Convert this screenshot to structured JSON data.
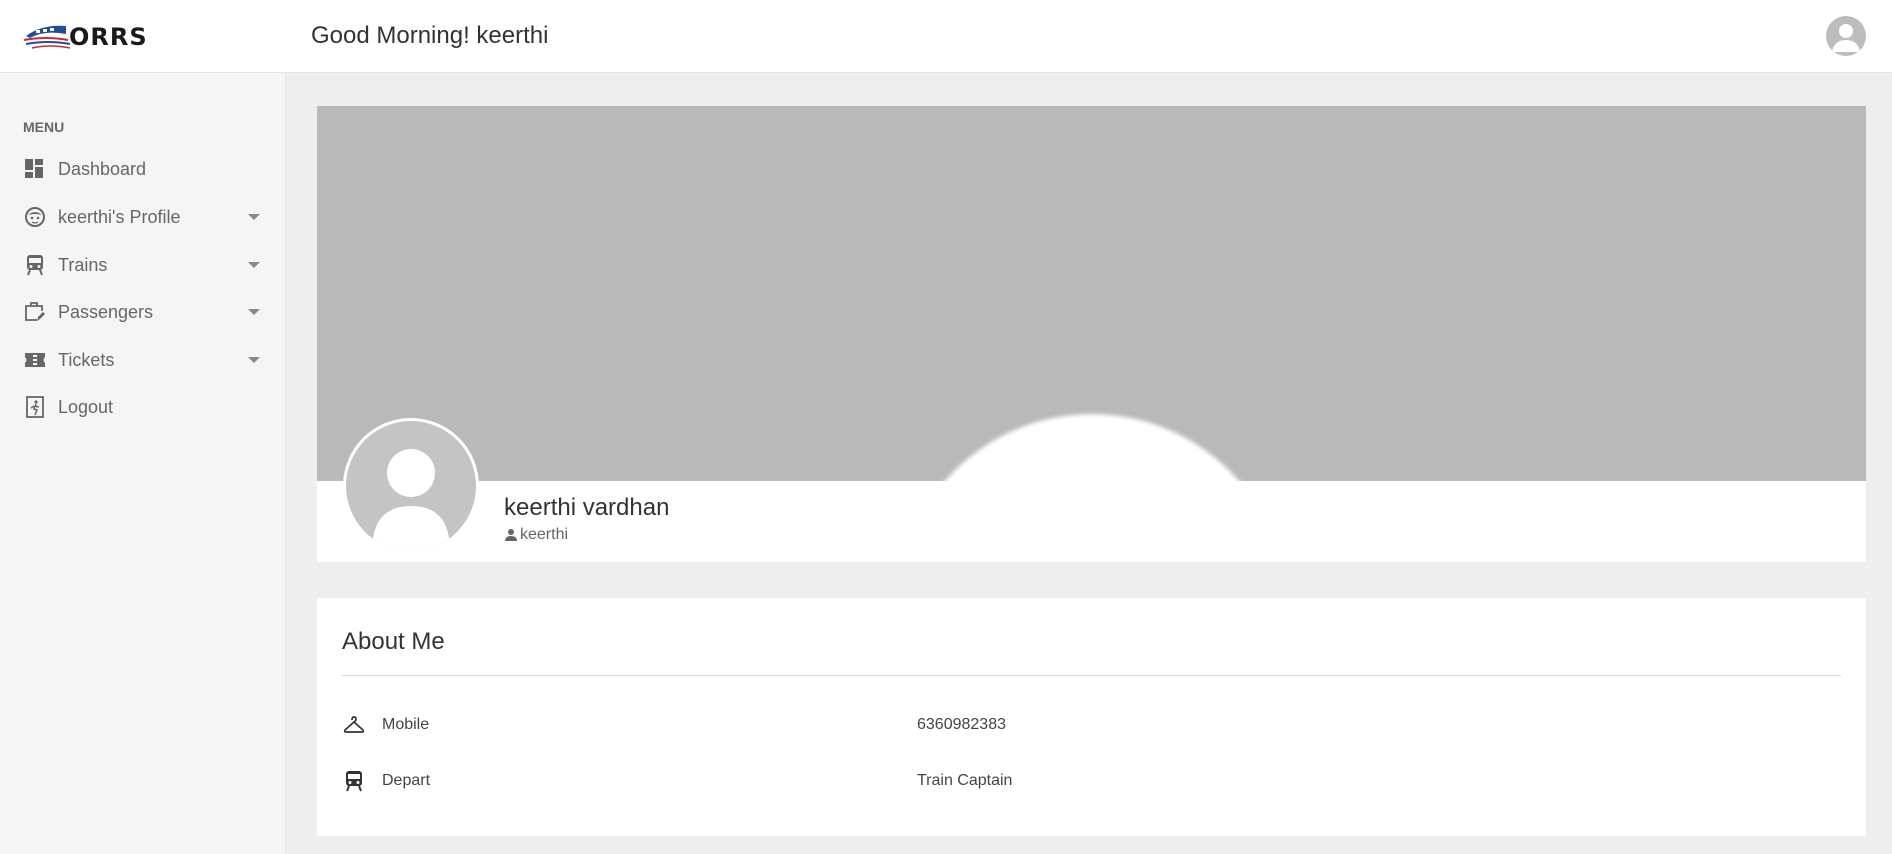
{
  "header": {
    "logo_text": "ORRS",
    "greeting": "Good Morning! keerthi"
  },
  "sidebar": {
    "menu_title": "MENU",
    "items": [
      {
        "label": "Dashboard",
        "icon": "dashboard-icon",
        "has_submenu": false
      },
      {
        "label": "keerthi's Profile",
        "icon": "face-icon",
        "has_submenu": true
      },
      {
        "label": "Trains",
        "icon": "train-icon",
        "has_submenu": true
      },
      {
        "label": "Passengers",
        "icon": "luggage-edit-icon",
        "has_submenu": true
      },
      {
        "label": "Tickets",
        "icon": "ticket-icon",
        "has_submenu": true
      },
      {
        "label": "Logout",
        "icon": "exit-icon",
        "has_submenu": false
      }
    ]
  },
  "profile": {
    "full_name": "keerthi vardhan",
    "username": "keerthi"
  },
  "about": {
    "title": "About Me",
    "rows": [
      {
        "label": "Mobile",
        "value": "6360982383",
        "icon": "hanger-icon"
      },
      {
        "label": "Depart",
        "value": "Train Captain",
        "icon": "train-icon"
      }
    ]
  },
  "colors": {
    "cover": "#b9b9b9",
    "sidebar_bg": "#f5f5f5",
    "page_bg": "#eeeeee",
    "logo_red": "#d9262c",
    "logo_blue": "#1e4f9c"
  }
}
